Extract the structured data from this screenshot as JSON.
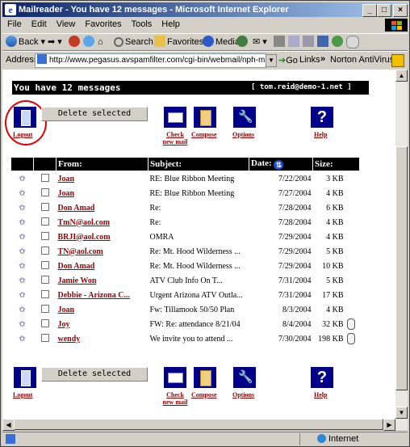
{
  "window": {
    "title": "Mailreader - You have 12 messages - Microsoft Internet Explorer",
    "controls": [
      "_",
      "□",
      "×"
    ]
  },
  "menu": [
    {
      "label": "File"
    },
    {
      "label": "Edit"
    },
    {
      "label": "View"
    },
    {
      "label": "Favorites"
    },
    {
      "label": "Tools"
    },
    {
      "label": "Help"
    }
  ],
  "toolbar": {
    "back": "Back",
    "search": "Search",
    "favorites": "Favorites",
    "media": "Media"
  },
  "address": {
    "label": "Address",
    "url": "http://www.pegasus.avspamfilter.com/cgi-bin/webmail/nph-mr.cgi?confi",
    "go": "Go",
    "links": "Links",
    "chevron": "»",
    "norton": "Norton AntiVirus"
  },
  "mail": {
    "header_text": "You have 12 messages",
    "account": "[ tom.reid@demo-1.net ]",
    "delete_label": "Delete selected",
    "logout_label": "Logout",
    "check_label": "Check new mail",
    "compose_label": "Compose",
    "options_label": "Options",
    "help_label": "Help",
    "columns": {
      "from": "From:",
      "subject": "Subject:",
      "date": "Date:",
      "size": "Size:"
    },
    "messages": [
      {
        "from": "Joan",
        "subject": "RE: Blue Ribbon Meeting",
        "date": "7/22/2004",
        "size": "3 KB",
        "attachment": false
      },
      {
        "from": "Joan",
        "subject": "RE: Blue Ribbon Meeting",
        "date": "7/27/2004",
        "size": "4 KB",
        "attachment": false
      },
      {
        "from": "Don Amad",
        "subject": "Re:",
        "date": "7/28/2004",
        "size": "6 KB",
        "attachment": false
      },
      {
        "from": "TmN@aol.com",
        "subject": "Re:",
        "date": "7/28/2004",
        "size": "4 KB",
        "attachment": false
      },
      {
        "from": "BRJI@aol.com",
        "subject": "OMRA",
        "date": "7/29/2004",
        "size": "4 KB",
        "attachment": false
      },
      {
        "from": "TN@aol.com",
        "subject": "Re: Mt. Hood Wilderness ...",
        "date": "7/29/2004",
        "size": "5 KB",
        "attachment": false
      },
      {
        "from": "Don Amad",
        "subject": "Re: Mt. Hood Wilderness ...",
        "date": "7/29/2004",
        "size": "10 KB",
        "attachment": false
      },
      {
        "from": "Jamie Won",
        "subject": "ATV Club Info On T...",
        "date": "7/31/2004",
        "size": "5 KB",
        "attachment": false
      },
      {
        "from": "Debbie - Arizona C...",
        "subject": "Urgent Arizona ATV Outla...",
        "date": "7/31/2004",
        "size": "17 KB",
        "attachment": false
      },
      {
        "from": "Joan",
        "subject": "Fw: Tillamook 50/50 Plan",
        "date": "8/3/2004",
        "size": "4 KB",
        "attachment": false
      },
      {
        "from": "Joy",
        "subject": "FW: Re: attendance 8/21/04",
        "date": "8/4/2004",
        "size": "32 KB",
        "attachment": true
      },
      {
        "from": "wendy",
        "subject": "We invite you to attend ...",
        "date": "7/30/2004",
        "size": "198 KB",
        "attachment": true
      }
    ]
  },
  "status": {
    "zone": "Internet"
  }
}
